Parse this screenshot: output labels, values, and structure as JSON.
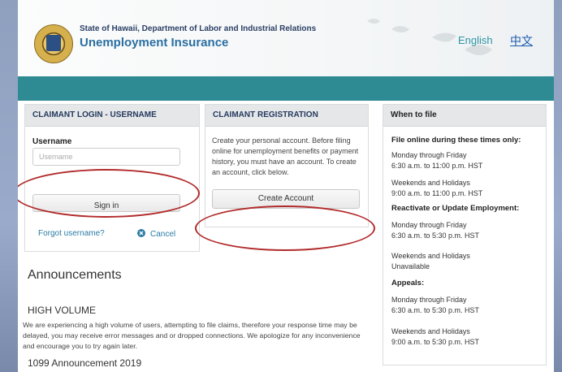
{
  "header": {
    "agency": "State of Hawaii, Department of Labor and Industrial Relations",
    "title": "Unemployment Insurance",
    "languages": [
      "English",
      "中文"
    ]
  },
  "login": {
    "heading": "CLAIMANT LOGIN - USERNAME",
    "username_label": "Username",
    "username_placeholder": "Username",
    "sign_in": "Sign in",
    "forgot": "Forgot username?",
    "cancel": "Cancel"
  },
  "registration": {
    "heading": "CLAIMANT REGISTRATION",
    "text": "Create your personal account. Before filing online for unemployment benefits or payment history, you must have an account. To create an account, click below.",
    "create_account": "Create Account"
  },
  "when_to_file": {
    "heading": "When to file",
    "lines": [
      "File online during these times only:",
      "Monday through Friday",
      "6:30 a.m. to 11:00 p.m. HST",
      "Weekends and Holidays",
      "9:00 a.m. to 11:00 p.m. HST",
      "Reactivate or Update Employment:",
      "Monday through Friday",
      "6:30 a.m. to 5:30 p.m. HST",
      "Weekends and Holidays",
      "Unavailable",
      "Appeals:",
      "Monday through Friday",
      "6:30 a.m. to 5:30 p.m. HST",
      "Weekends and Holidays",
      "9:00 a.m. to 5:30 p.m. HST"
    ]
  },
  "announcements": {
    "title": "Announcements",
    "item1_title": "HIGH VOLUME",
    "item1_text": "We are experiencing a high volume of users, attempting to file claims, therefore your response time may be delayed, you may receive error messages and or dropped connections. We apologize for any inconvenience and encourage you to try again later.",
    "item2_title": "1099 Announcement 2019"
  },
  "colors": {
    "band": "#2e8a93",
    "annotation": "#b22b2b"
  },
  "icons": [
    "state-seal-icon",
    "cancel-circle-icon"
  ]
}
